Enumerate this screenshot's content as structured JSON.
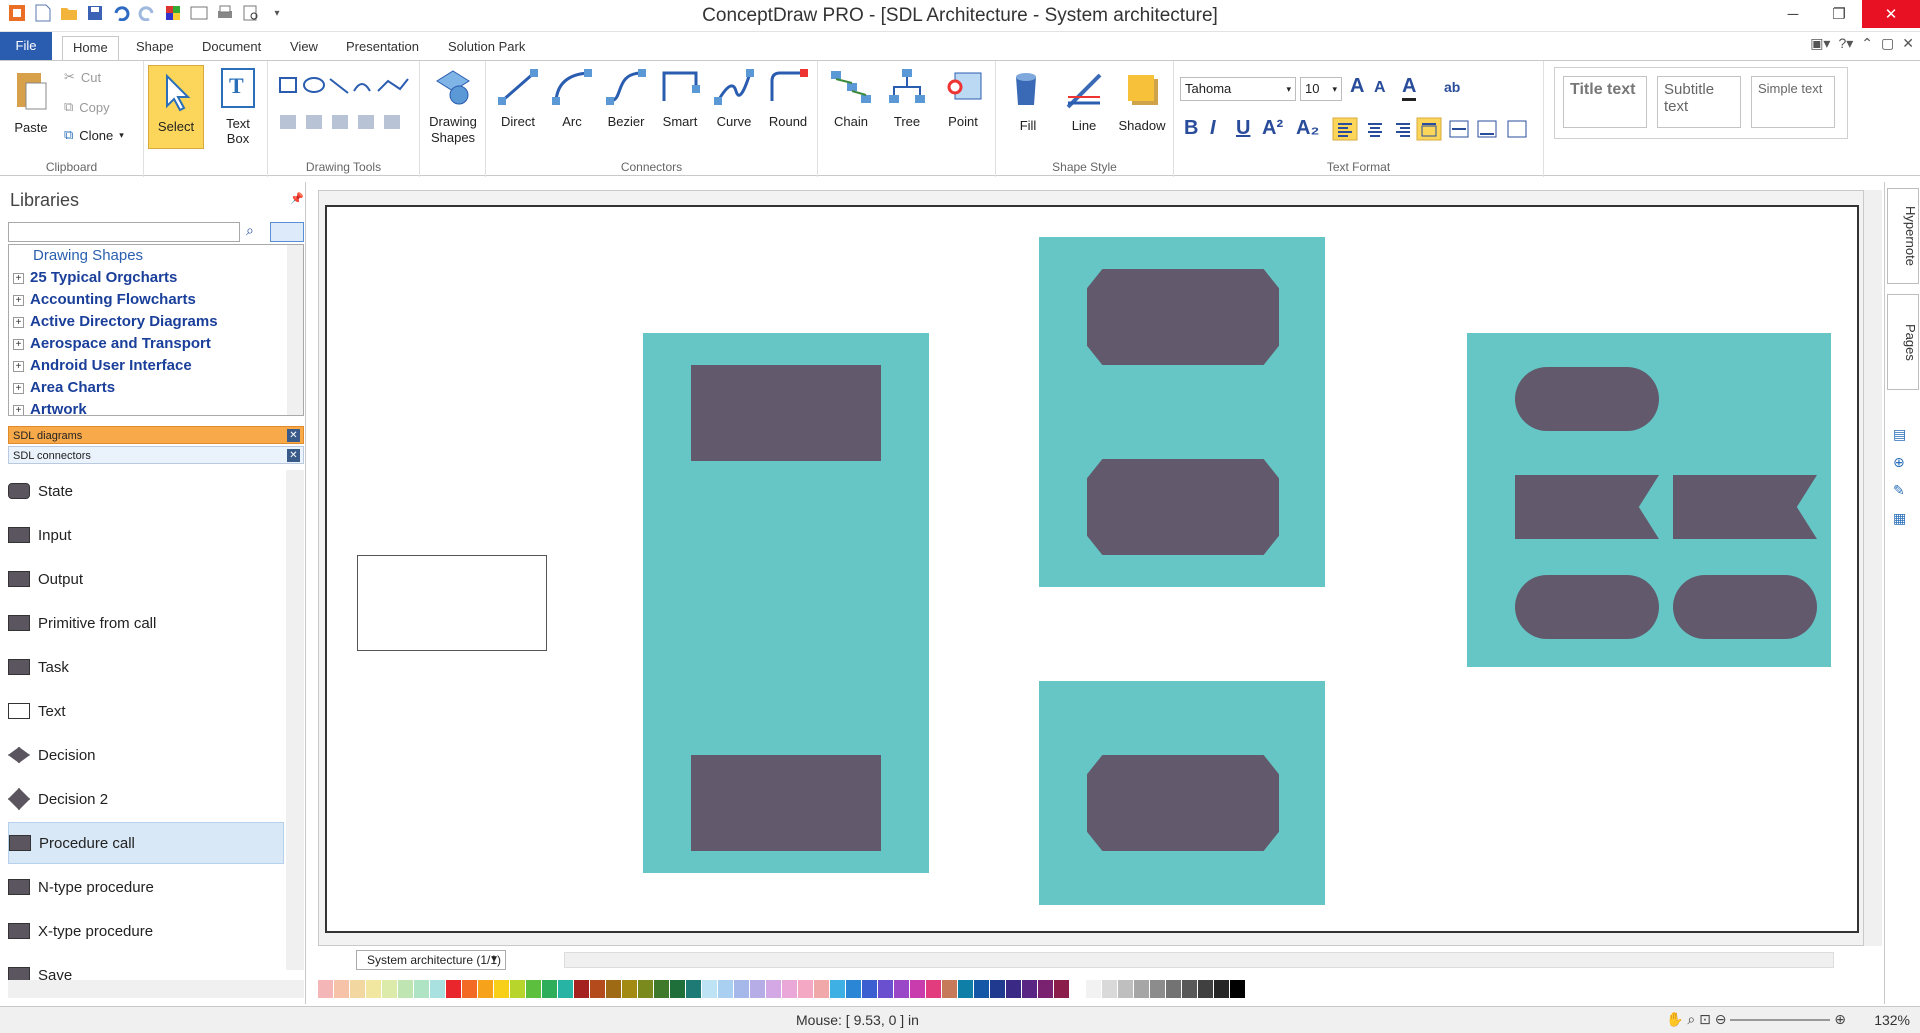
{
  "app": {
    "title": "ConceptDraw PRO - [SDL Architecture - System architecture]"
  },
  "menu": {
    "file": "File",
    "tabs": [
      "Home",
      "Shape",
      "Document",
      "View",
      "Presentation",
      "Solution Park"
    ]
  },
  "ribbon": {
    "clipboard": {
      "paste": "Paste",
      "cut": "Cut",
      "copy": "Copy",
      "clone": "Clone",
      "label": "Clipboard"
    },
    "select": {
      "label": "Select"
    },
    "textbox": {
      "label": "Text Box"
    },
    "drawing_tools": {
      "label": "Drawing Tools"
    },
    "drawing_shapes": {
      "label": "Drawing Shapes"
    },
    "connectors": {
      "items": [
        "Direct",
        "Arc",
        "Bezier",
        "Smart",
        "Curve",
        "Round"
      ],
      "label": "Connectors"
    },
    "misc": {
      "items": [
        "Chain",
        "Tree",
        "Point"
      ]
    },
    "shape_style": {
      "fill": "Fill",
      "line": "Line",
      "shadow": "Shadow",
      "label": "Shape Style"
    },
    "text_format": {
      "font": "Tahoma",
      "size": "10",
      "label": "Text Format"
    },
    "styles": {
      "title": "Title text",
      "subtitle": "Subtitle text",
      "simple": "Simple text"
    }
  },
  "libraries": {
    "title": "Libraries",
    "search_placeholder": "",
    "tree": {
      "root": "Drawing Shapes",
      "nodes": [
        "25 Typical Orgcharts",
        "Accounting Flowcharts",
        "Active Directory Diagrams",
        "Aerospace and Transport",
        "Android User Interface",
        "Area Charts",
        "Artwork"
      ]
    },
    "open_libs": [
      "SDL diagrams",
      "SDL connectors"
    ],
    "shapes": [
      "State",
      "Input",
      "Output",
      "Primitive from call",
      "Task",
      "Text",
      "Decision",
      "Decision 2",
      "Procedure call",
      "N-type procedure",
      "X-type procedure",
      "Save"
    ],
    "selected_shape": "Procedure call"
  },
  "document": {
    "page_tab": "System architecture (1/1)"
  },
  "right_dock": {
    "tabs": [
      "Hypernote",
      "Pages"
    ]
  },
  "status": {
    "mouse": "Mouse: [ 9.53, 0 ] in",
    "zoom": "132%"
  },
  "colors": {
    "teal": "#66c6c6",
    "dark": "#625a6c",
    "accent": "#2a5cb0"
  },
  "palette": [
    "#f4b6b6",
    "#f6c3a8",
    "#f3d7a0",
    "#f1e7a1",
    "#dcebaa",
    "#bfe6b2",
    "#aee3c4",
    "#a8e1e0",
    "#e8262c",
    "#f26a24",
    "#f7a21b",
    "#f8d01a",
    "#b8d52b",
    "#5cbf3d",
    "#2ead5a",
    "#28b4a5",
    "#a4211f",
    "#b34b1c",
    "#9e6a13",
    "#a38a12",
    "#7a8a1c",
    "#3f7a2a",
    "#1f6f3a",
    "#1d7a74",
    "#bde3f4",
    "#a9d0f1",
    "#a6b8ea",
    "#b7ade6",
    "#d3a8e4",
    "#eaa8d8",
    "#f4a8c4",
    "#f1a8a8",
    "#3fb0e4",
    "#2b86d6",
    "#3b5fd1",
    "#6a4fcf",
    "#9a47c8",
    "#c83cae",
    "#e23b7e",
    "#c77a5a",
    "#0f7fa8",
    "#1457a6",
    "#1f3a8f",
    "#3a2a86",
    "#5a2684",
    "#7a2270",
    "#8a1d4a",
    "#ffffff",
    "#f2f2f2",
    "#d9d9d9",
    "#bfbfbf",
    "#a6a6a6",
    "#8c8c8c",
    "#737373",
    "#595959",
    "#404040",
    "#262626",
    "#000000"
  ]
}
